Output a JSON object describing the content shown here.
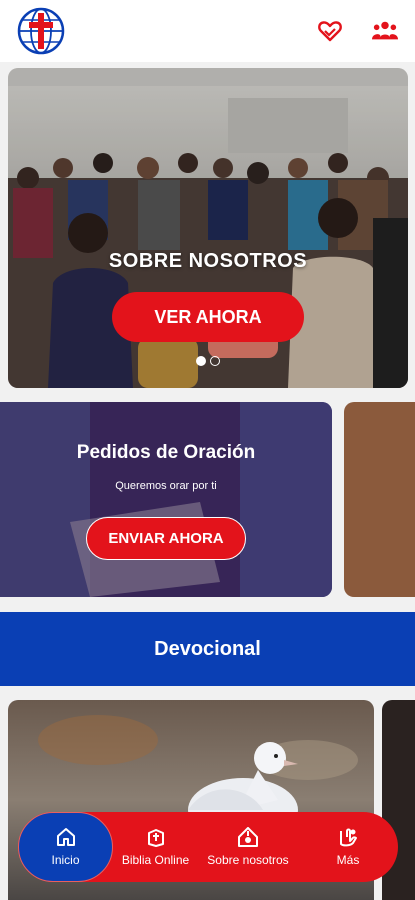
{
  "header": {
    "logo_icon": "church-cross-globe-logo",
    "actions": [
      {
        "icon": "hands-heart-icon"
      },
      {
        "icon": "people-group-icon"
      }
    ],
    "colors": {
      "brand_red": "#e3131b",
      "brand_blue": "#0a3fb4"
    }
  },
  "hero": {
    "title": "SOBRE NOSOTROS",
    "button_label": "VER AHORA",
    "slides_total": 2,
    "slide_active": 1
  },
  "prayer_card": {
    "title": "Pedidos de Oración",
    "subtitle": "Queremos orar por ti",
    "button_label": "ENVIAR AHORA"
  },
  "devotional": {
    "title": "Devocional"
  },
  "bottom_nav": {
    "items": [
      {
        "label": "Inicio",
        "icon": "home-icon",
        "active": true
      },
      {
        "label": "Biblia Online",
        "icon": "bible-icon",
        "active": false
      },
      {
        "label": "Sobre nosotros",
        "icon": "church-icon",
        "active": false
      },
      {
        "label": "Más",
        "icon": "hand-heart-icon",
        "active": false
      }
    ]
  }
}
